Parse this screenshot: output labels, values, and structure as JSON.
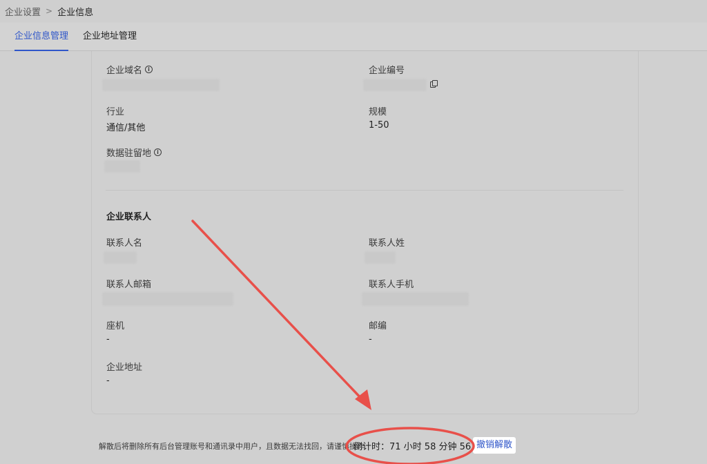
{
  "breadcrumb": {
    "parent": "企业设置",
    "separator": ">",
    "current": "企业信息"
  },
  "tabs": [
    {
      "label": "企业信息管理",
      "active": true
    },
    {
      "label": "企业地址管理",
      "active": false
    }
  ],
  "company_info": {
    "domain_label": "企业域名",
    "number_label": "企业编号",
    "industry_label": "行业",
    "industry_value": "通信/其他",
    "scale_label": "规模",
    "scale_value": "1-50",
    "residency_label": "数据驻留地"
  },
  "contact": {
    "section_title": "企业联系人",
    "first_name_label": "联系人名",
    "last_name_label": "联系人姓",
    "email_label": "联系人邮箱",
    "mobile_label": "联系人手机",
    "landline_label": "座机",
    "landline_value": "-",
    "postcode_label": "邮编",
    "postcode_value": "-",
    "address_label": "企业地址",
    "address_value": "-"
  },
  "footer": {
    "note": "解散后将删除所有后台管理账号和通讯录中用户，且数据无法找回，请谨慎操作",
    "countdown": "倒计时：71 小时 58 分钟 56 秒",
    "undo_label": "撤销解散"
  },
  "colors": {
    "accent": "#2f56c9",
    "annotation": "#e8504a"
  },
  "icons": {
    "info": "info-circle-icon",
    "copy": "copy-icon"
  }
}
